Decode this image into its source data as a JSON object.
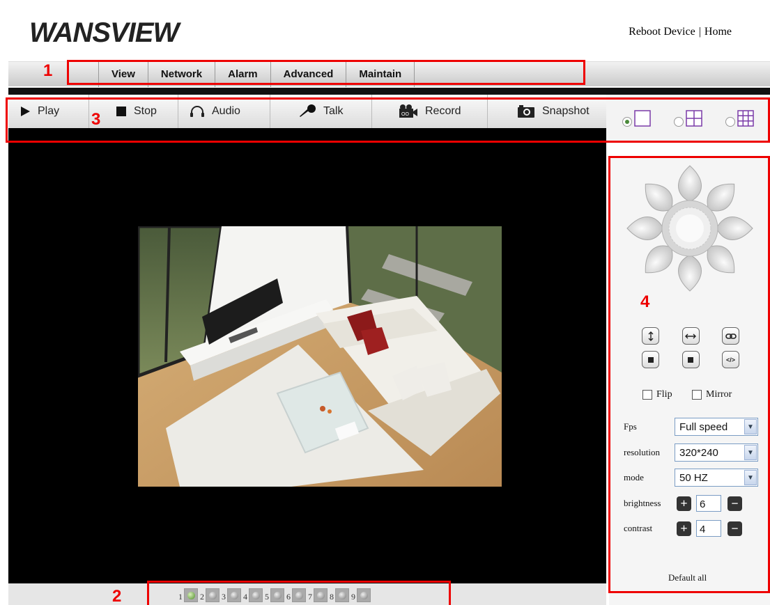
{
  "header": {
    "logo_text": "WANSVIEW",
    "reboot_label": "Reboot Device",
    "separator": "|",
    "home_label": "Home"
  },
  "menu": {
    "items": [
      {
        "label": "View"
      },
      {
        "label": "Network"
      },
      {
        "label": "Alarm"
      },
      {
        "label": "Advanced"
      },
      {
        "label": "Maintain"
      }
    ]
  },
  "toolbar": {
    "buttons": [
      {
        "label": "Play",
        "icon": "play-icon"
      },
      {
        "label": "Stop",
        "icon": "stop-icon"
      },
      {
        "label": "Audio",
        "icon": "headphones-icon"
      },
      {
        "label": "Talk",
        "icon": "microphone-icon"
      },
      {
        "label": "Record",
        "icon": "video-camera-icon"
      },
      {
        "label": "Snapshot",
        "icon": "camera-icon"
      }
    ]
  },
  "split_view": {
    "options": [
      "single-view",
      "quad-view",
      "nine-view"
    ],
    "selected_index": 0
  },
  "channels": {
    "numbers": [
      "1",
      "2",
      "3",
      "4",
      "5",
      "6",
      "7",
      "8",
      "9"
    ],
    "active_index": 0
  },
  "ptz": {
    "buttons_row1": [
      "vertical-patrol-icon",
      "horizontal-patrol-icon",
      "link-icon"
    ],
    "buttons_row2": [
      "stop-icon",
      "stop-icon",
      "code-icon"
    ],
    "code_glyph": "</>"
  },
  "checks": {
    "flip": "Flip",
    "mirror": "Mirror"
  },
  "settings": {
    "fps_label": "Fps",
    "fps_value": "Full speed",
    "resolution_label": "resolution",
    "resolution_value": "320*240",
    "mode_label": "mode",
    "mode_value": "50 HZ",
    "brightness_label": "brightness",
    "brightness_value": "6",
    "contrast_label": "contrast",
    "contrast_value": "4",
    "plus": "+",
    "minus": "−"
  },
  "default_all": "Default all",
  "annotations": {
    "box1": "1",
    "box2": "2",
    "box3": "3",
    "box4": "4"
  },
  "colors": {
    "annotation": "#e00000",
    "accent_green": "#4e8c2a"
  }
}
